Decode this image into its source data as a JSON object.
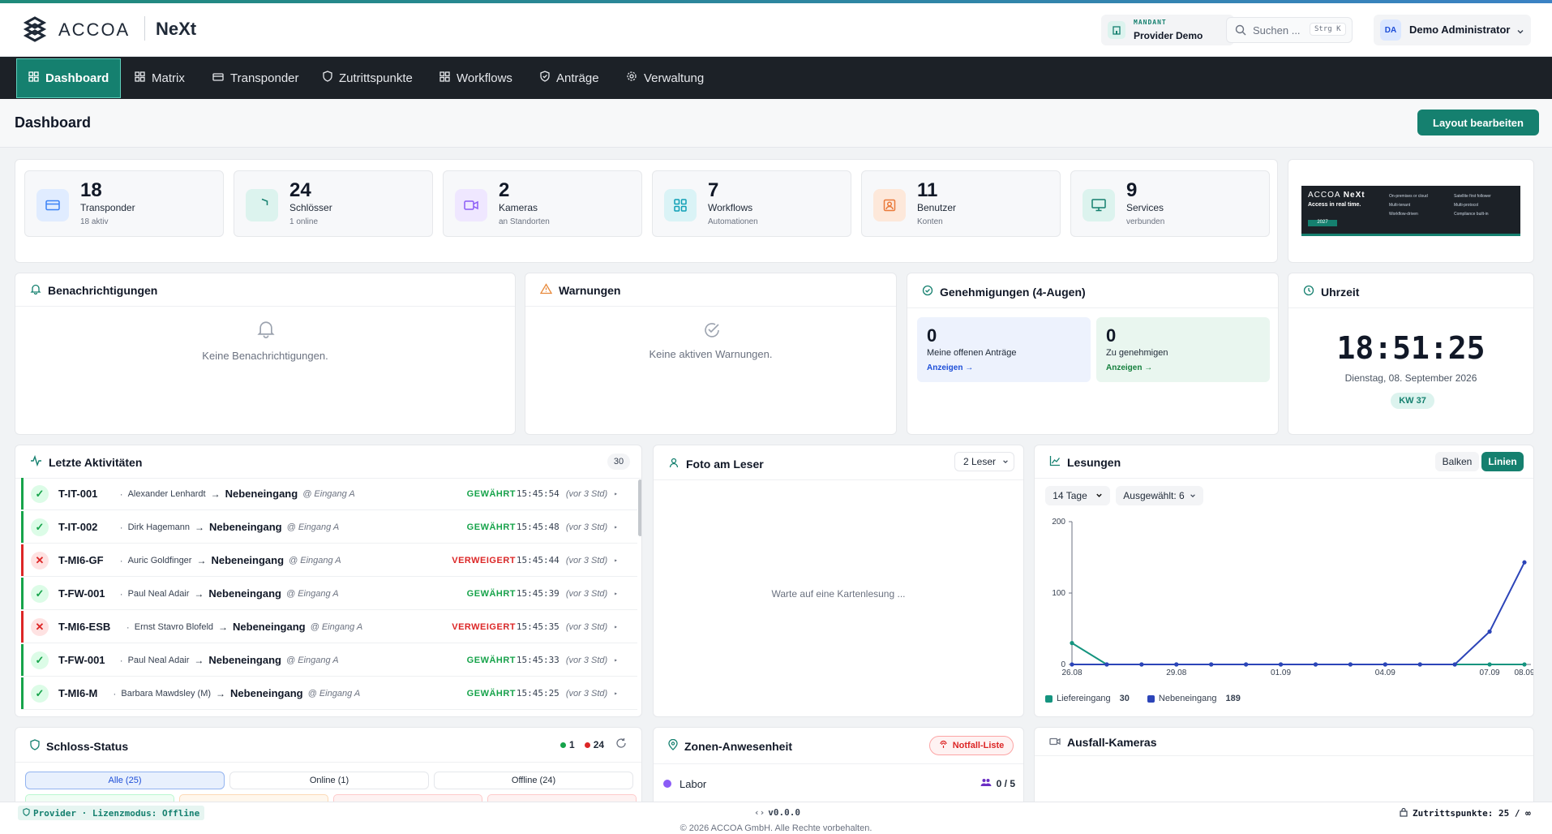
{
  "brand": {
    "logo_text": "ACCOA",
    "product": "NeXt"
  },
  "mandant": {
    "label": "MANDANT",
    "value": "Provider Demo"
  },
  "search": {
    "placeholder": "Suchen ...",
    "shortcut": "Strg K"
  },
  "user": {
    "initials": "DA",
    "name": "Demo Administrator"
  },
  "nav": [
    {
      "label": "Dashboard",
      "icon": "grid-icon",
      "active": true
    },
    {
      "label": "Matrix",
      "icon": "grid-icon"
    },
    {
      "label": "Transponder",
      "icon": "card-icon"
    },
    {
      "label": "Zutrittspunkte",
      "icon": "shield-icon"
    },
    {
      "label": "Workflows",
      "icon": "grid-icon"
    },
    {
      "label": "Anträge",
      "icon": "shield-check-icon"
    },
    {
      "label": "Verwaltung",
      "icon": "gear-icon"
    }
  ],
  "page": {
    "title": "Dashboard",
    "edit_layout": "Layout bearbeiten"
  },
  "stats": [
    {
      "value": "18",
      "label": "Transponder",
      "sub": "18 aktiv",
      "color": "#3b82f6",
      "bg": "#e0ecff",
      "icon": "card-icon"
    },
    {
      "value": "24",
      "label": "Schlösser",
      "sub": "1 online",
      "color": "#15806f",
      "bg": "#dcf3ee",
      "icon": "shield-icon"
    },
    {
      "value": "2",
      "label": "Kameras",
      "sub": "an Standorten",
      "color": "#8b5cf6",
      "bg": "#efe7ff",
      "icon": "camera-icon"
    },
    {
      "value": "7",
      "label": "Workflows",
      "sub": "Automationen",
      "color": "#0e9fb5",
      "bg": "#daf3f6",
      "icon": "grid-icon"
    },
    {
      "value": "11",
      "label": "Benutzer",
      "sub": "Konten",
      "color": "#ea7a3a",
      "bg": "#fde8da",
      "icon": "user-icon"
    },
    {
      "value": "9",
      "label": "Services",
      "sub": "verbunden",
      "color": "#15806f",
      "bg": "#dcf3ee",
      "icon": "monitor-icon"
    }
  ],
  "banner": {
    "logo": "ACCOA",
    "product": "NeXt",
    "tagline": "Access in real time.",
    "badge": "2027",
    "bullets": [
      "On-premises or cloud",
      "Multi-tenant",
      "Workflow-driven",
      "Satellite first follower",
      "Multi-protocol",
      "Compliance built-in"
    ]
  },
  "notifications": {
    "title": "Benachrichtigungen",
    "empty": "Keine Benachrichtigungen."
  },
  "warnings": {
    "title": "Warnungen",
    "empty": "Keine aktiven Warnungen."
  },
  "approvals": {
    "title": "Genehmigungen (4-Augen)",
    "mine": {
      "value": "0",
      "label": "Meine offenen Anträge",
      "link": "Anzeigen →"
    },
    "approve": {
      "value": "0",
      "label": "Zu genehmigen",
      "link": "Anzeigen →"
    }
  },
  "clock": {
    "title": "Uhrzeit",
    "time": "18:51:25",
    "date": "Dienstag, 08. September 2026",
    "week": "KW 37"
  },
  "activities": {
    "title": "Letzte Aktivitäten",
    "count": "30",
    "rows": [
      {
        "ok": true,
        "tid": "T-IT-001",
        "person": "Alexander Lenhardt",
        "target": "Nebeneingang",
        "loc": "@ Eingang A",
        "result": "GEWÄHRT",
        "time": "15:45:54",
        "ago": "(vor 3 Std)"
      },
      {
        "ok": true,
        "tid": "T-IT-002",
        "person": "Dirk Hagemann",
        "target": "Nebeneingang",
        "loc": "@ Eingang A",
        "result": "GEWÄHRT",
        "time": "15:45:48",
        "ago": "(vor 3 Std)"
      },
      {
        "ok": false,
        "tid": "T-MI6-GF",
        "person": "Auric Goldfinger",
        "target": "Nebeneingang",
        "loc": "@ Eingang A",
        "result": "VERWEIGERT",
        "time": "15:45:44",
        "ago": "(vor 3 Std)"
      },
      {
        "ok": true,
        "tid": "T-FW-001",
        "person": "Paul Neal Adair",
        "target": "Nebeneingang",
        "loc": "@ Eingang A",
        "result": "GEWÄHRT",
        "time": "15:45:39",
        "ago": "(vor 3 Std)"
      },
      {
        "ok": false,
        "tid": "T-MI6-ESB",
        "person": "Ernst Stavro Blofeld",
        "target": "Nebeneingang",
        "loc": "@ Eingang A",
        "result": "VERWEIGERT",
        "time": "15:45:35",
        "ago": "(vor 3 Std)"
      },
      {
        "ok": true,
        "tid": "T-FW-001",
        "person": "Paul Neal Adair",
        "target": "Nebeneingang",
        "loc": "@ Eingang A",
        "result": "GEWÄHRT",
        "time": "15:45:33",
        "ago": "(vor 3 Std)"
      },
      {
        "ok": true,
        "tid": "T-MI6-M",
        "person": "Barbara Mawdsley (M)",
        "target": "Nebeneingang",
        "loc": "@ Eingang A",
        "result": "GEWÄHRT",
        "time": "15:45:25",
        "ago": "(vor 3 Std)"
      }
    ]
  },
  "photo": {
    "title": "Foto am Leser",
    "reader_select": "2 Leser",
    "waiting": "Warte auf eine Kartenlesung ..."
  },
  "readings": {
    "title": "Lesungen",
    "bars_btn": "Balken",
    "lines_btn": "Linien",
    "range": "14 Tage",
    "selected": "Ausgewählt: 6"
  },
  "chart_data": {
    "type": "line",
    "x": [
      "26.08",
      "27.08",
      "28.08",
      "29.08",
      "30.08",
      "31.08",
      "01.09",
      "02.09",
      "03.09",
      "04.09",
      "05.09",
      "06.09",
      "07.09",
      "08.09"
    ],
    "xticks": [
      "26.08",
      "29.08",
      "01.09",
      "04.09",
      "07.09",
      "08.09"
    ],
    "ylim": [
      0,
      200
    ],
    "yticks": [
      0,
      100,
      200
    ],
    "series": [
      {
        "name": "Liefereingang",
        "total": "30",
        "color": "#15947f",
        "values": [
          30,
          0,
          0,
          0,
          0,
          0,
          0,
          0,
          0,
          0,
          0,
          0,
          0,
          0
        ]
      },
      {
        "name": "Nebeneingang",
        "total": "189",
        "color": "#2c44b8",
        "values": [
          0,
          0,
          0,
          0,
          0,
          0,
          0,
          0,
          0,
          0,
          0,
          0,
          46,
          143
        ]
      }
    ]
  },
  "locks": {
    "title": "Schloss-Status",
    "online": "1",
    "offline": "24",
    "tabs": [
      "Alle (25)",
      "Online (1)",
      "Offline (24)"
    ]
  },
  "zones": {
    "title": "Zonen-Anwesenheit",
    "emergency": "Notfall-Liste",
    "items": [
      {
        "name": "Labor",
        "count": "0 / 5"
      }
    ]
  },
  "cameras": {
    "title": "Ausfall-Kameras"
  },
  "footer": {
    "provider": "Provider · Lizenzmodus: Offline",
    "version": "v0.0.0",
    "copyright": "© 2026 ACCOA GmbH. Alle Rechte vorbehalten.",
    "points": "Zutrittspunkte: 25 / ∞"
  }
}
